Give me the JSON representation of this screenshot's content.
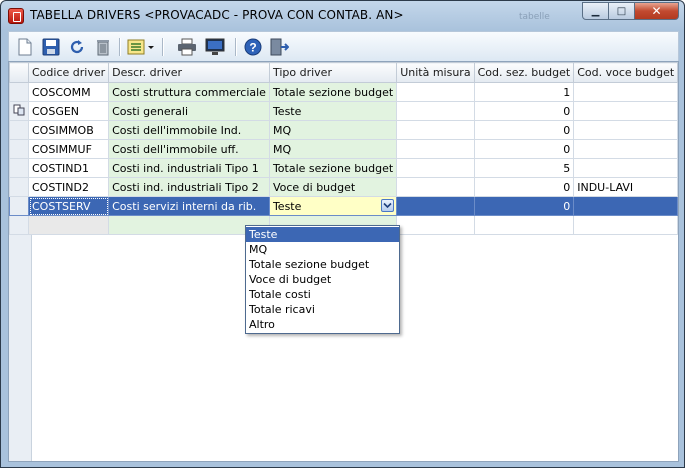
{
  "window": {
    "title": "TABELLA DRIVERS <PROVACADC - PROVA CON CONTAB. AN>",
    "ghost_text": "tabelle",
    "controls": {
      "minimize": "▁",
      "maximize": "□",
      "close": "✕"
    }
  },
  "toolbar": {
    "items": [
      "new-document-icon",
      "save-icon",
      "refresh-icon",
      "delete-icon",
      "list-options-icon",
      "print-icon",
      "preview-monitor-icon",
      "help-icon",
      "exit-icon"
    ]
  },
  "grid": {
    "columns": [
      "Codice driver",
      "Descr. driver",
      "Tipo driver",
      "Unità misura",
      "Cod. sez. budget",
      "Cod. voce budget"
    ],
    "rows": [
      {
        "code": "COSCOMM",
        "desc": "Costi struttura commerciale",
        "type": "Totale sezione budget",
        "unit": "",
        "sez": "1",
        "voce": ""
      },
      {
        "code": "COSGEN",
        "desc": "Costi generali",
        "type": "Teste",
        "unit": "",
        "sez": "0",
        "voce": ""
      },
      {
        "code": "COSIMMOB",
        "desc": "Costi dell'immobile Ind.",
        "type": "MQ",
        "unit": "",
        "sez": "0",
        "voce": ""
      },
      {
        "code": "COSIMMUF",
        "desc": "Costi dell'immobile uff.",
        "type": "MQ",
        "unit": "",
        "sez": "0",
        "voce": ""
      },
      {
        "code": "COSTIND1",
        "desc": "Costi ind. industriali Tipo 1",
        "type": "Totale sezione budget",
        "unit": "",
        "sez": "5",
        "voce": ""
      },
      {
        "code": "COSTIND2",
        "desc": "Costi ind. industriali Tipo 2",
        "type": "Voce di budget",
        "unit": "",
        "sez": "0",
        "voce": "INDU-LAVI"
      },
      {
        "code": "COSTSERV",
        "desc": "Costi servizi interni da rib.",
        "type": "Teste",
        "unit": "",
        "sez": "0",
        "voce": ""
      }
    ]
  },
  "dropdown": {
    "selected": "Teste",
    "options": [
      "Teste",
      "MQ",
      "Totale sezione budget",
      "Voce di budget",
      "Totale costi",
      "Totale ricavi",
      "Altro"
    ]
  },
  "colors": {
    "selection": "#3c67b4",
    "editable_cell": "#e2f3e0",
    "editing_cell": "#ffffc6"
  }
}
